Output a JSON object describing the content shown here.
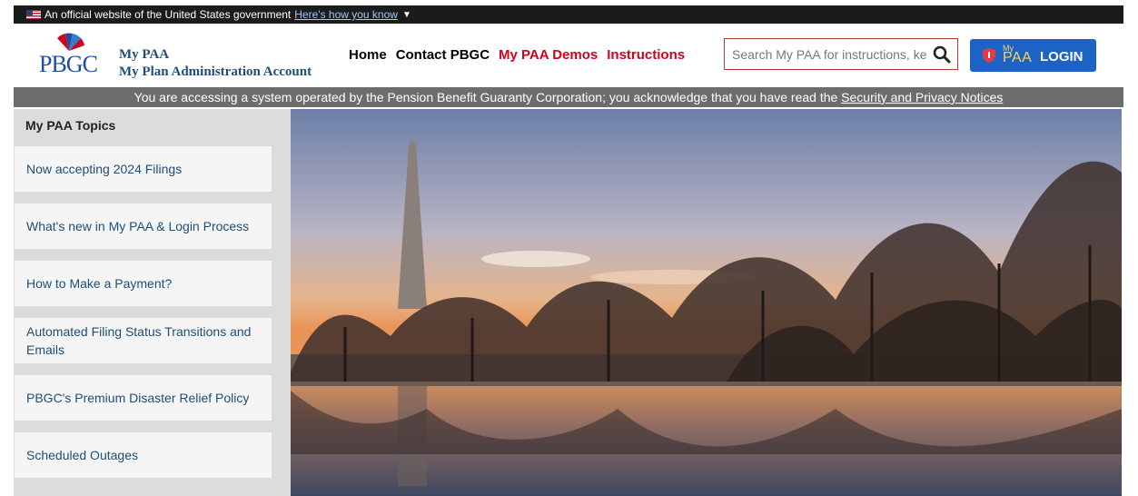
{
  "gov_banner": {
    "text": "An official website of the United States government",
    "link": "Here's how you know"
  },
  "header": {
    "logo_text": "PBGC",
    "brand_line1": "My PAA",
    "brand_line2": "My Plan Administration Account"
  },
  "nav": {
    "home": "Home",
    "contact": "Contact PBGC",
    "demos": "My PAA Demos",
    "instructions": "Instructions"
  },
  "search": {
    "placeholder": "Search My PAA for instructions, ke"
  },
  "login": {
    "my": "My",
    "paa": "PAA",
    "label": "LOGIN"
  },
  "notice": {
    "text": "You are accessing a system operated by the Pension Benefit Guaranty Corporation; you acknowledge that you have read the ",
    "link": "Security and Privacy Notices"
  },
  "sidebar": {
    "title": "My PAA Topics",
    "items": [
      {
        "label": "Now accepting 2024 Filings"
      },
      {
        "label": "What's new in My PAA & Login Process"
      },
      {
        "label": "How to Make a Payment?"
      },
      {
        "label": "Automated Filing Status Transitions and Emails"
      },
      {
        "label": "PBGC's Premium Disaster Relief Policy"
      },
      {
        "label": "Scheduled Outages"
      }
    ]
  },
  "colors": {
    "nav_red": "#d0021b",
    "login_blue": "#1d63c6",
    "brand_blue": "#1f4e79"
  }
}
